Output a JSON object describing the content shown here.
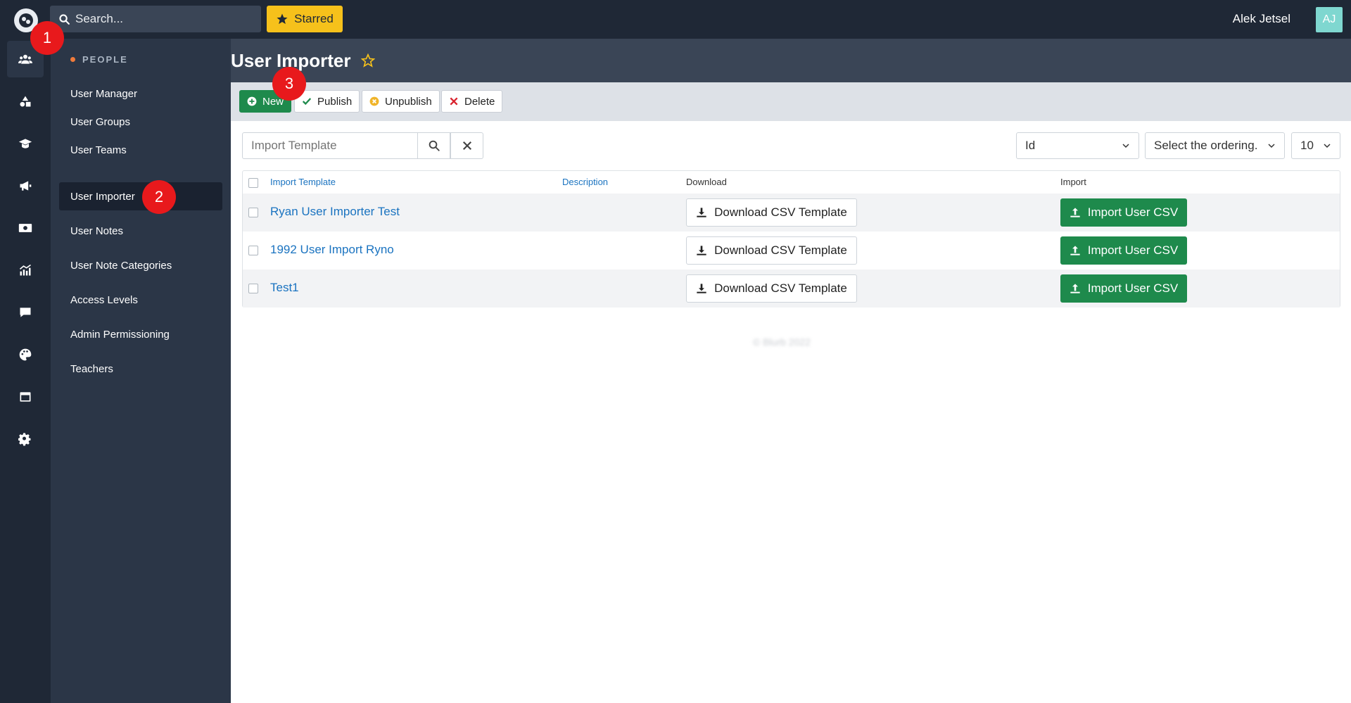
{
  "topbar": {
    "search_placeholder": "Search...",
    "starred_label": "Starred",
    "user_name": "Alek Jetsel",
    "avatar_initials": "AJ"
  },
  "rail": {
    "icons": [
      "users-icon",
      "shapes-icon",
      "graduation-cap-icon",
      "megaphone-icon",
      "money-icon",
      "chart-icon",
      "comment-icon",
      "palette-icon",
      "window-icon",
      "gear-icon"
    ],
    "active_index": 0
  },
  "sidemenu": {
    "section": "PEOPLE",
    "items": [
      {
        "label": "User Manager"
      },
      {
        "label": "User Groups"
      },
      {
        "label": "User Teams"
      },
      {
        "label": "User Importer"
      },
      {
        "label": "User Notes"
      },
      {
        "label": "User Note Categories"
      },
      {
        "label": "Access Levels"
      },
      {
        "label": "Admin Permissioning"
      },
      {
        "label": "Teachers"
      }
    ],
    "active_index": 3
  },
  "header": {
    "title": "User Importer"
  },
  "toolbar": {
    "new_label": "New",
    "publish_label": "Publish",
    "unpublish_label": "Unpublish",
    "delete_label": "Delete"
  },
  "filters": {
    "search_placeholder": "Import Template",
    "sort_field": "Id",
    "ordering_placeholder": "Select the ordering.",
    "page_size": "10"
  },
  "table": {
    "headers": {
      "import_template": "Import Template",
      "description": "Description",
      "download": "Download",
      "import": "Import"
    },
    "rows": [
      {
        "name": "Ryan User Importer Test",
        "description": "",
        "download_label": "Download CSV Template",
        "import_label": "Import User CSV"
      },
      {
        "name": "1992 User Import Ryno",
        "description": "",
        "download_label": "Download CSV Template",
        "import_label": "Import User CSV"
      },
      {
        "name": "Test1",
        "description": "",
        "download_label": "Download CSV Template",
        "import_label": "Import User CSV"
      }
    ]
  },
  "footer": {
    "text": "© Blurb 2022"
  },
  "callouts": [
    "1",
    "2",
    "3"
  ],
  "colors": {
    "dark": "#1f2836",
    "sidebar": "#2b3647",
    "accent_green": "#1e8a4c",
    "link_blue": "#1a73c0",
    "starred_yellow": "#f6c11b",
    "callout_red": "#e8191c"
  }
}
